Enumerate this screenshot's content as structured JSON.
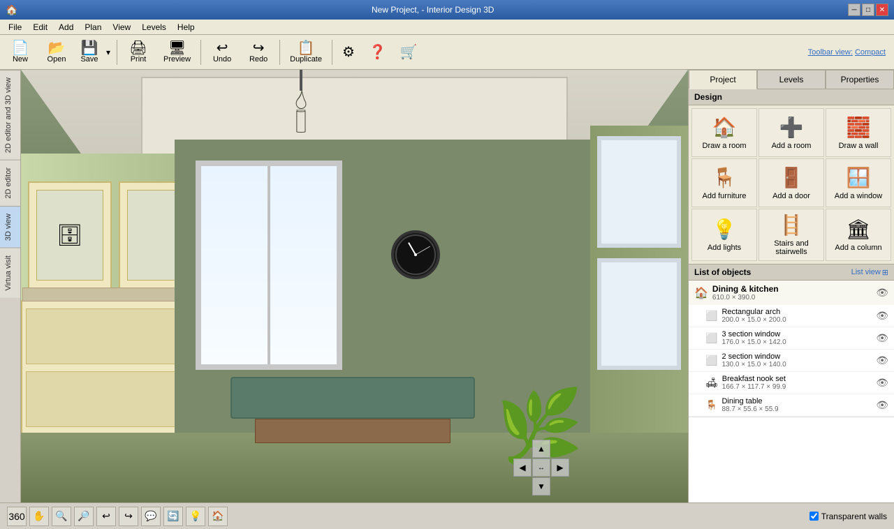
{
  "titlebar": {
    "app_icon": "🏠",
    "title": "New Project, - Interior Design 3D",
    "min_label": "─",
    "restore_label": "□",
    "close_label": "✕"
  },
  "menubar": {
    "items": [
      "File",
      "Edit",
      "Add",
      "Plan",
      "View",
      "Levels",
      "Help"
    ]
  },
  "toolbar": {
    "new_label": "New",
    "open_label": "Open",
    "save_label": "Save",
    "print_label": "Print",
    "preview_label": "Preview",
    "undo_label": "Undo",
    "redo_label": "Redo",
    "duplicate_label": "Duplicate",
    "settings_label": "⚙",
    "help_label": "?",
    "buy_label": "🛒",
    "toolbar_view_label": "Toolbar view:",
    "compact_label": "Compact"
  },
  "left_sidebar": {
    "tabs": [
      {
        "id": "2d-3d-editor",
        "label": "2D editor and 3D view"
      },
      {
        "id": "2d-editor",
        "label": "2D editor"
      },
      {
        "id": "3d-view",
        "label": "3D view"
      },
      {
        "id": "virtual-visit",
        "label": "Virtua visit"
      }
    ]
  },
  "right_panel": {
    "tabs": [
      "Project",
      "Levels",
      "Properties"
    ],
    "active_tab": "Project",
    "design_header": "Design",
    "design_items": [
      {
        "id": "draw-room",
        "icon": "🏠",
        "label": "Draw a room"
      },
      {
        "id": "add-room",
        "icon": "➕",
        "label": "Add a room"
      },
      {
        "id": "draw-wall",
        "icon": "🧱",
        "label": "Draw a wall"
      },
      {
        "id": "add-furniture",
        "icon": "🪑",
        "label": "Add furniture"
      },
      {
        "id": "add-door",
        "icon": "🚪",
        "label": "Add a door"
      },
      {
        "id": "add-window",
        "icon": "🪟",
        "label": "Add a window"
      },
      {
        "id": "add-lights",
        "icon": "💡",
        "label": "Add lights"
      },
      {
        "id": "stairs",
        "icon": "🪜",
        "label": "Stairs and stairwells"
      },
      {
        "id": "add-column",
        "icon": "🏛",
        "label": "Add a column"
      }
    ],
    "objects_header": "List of objects",
    "list_view_label": "List view",
    "objects": [
      {
        "id": "dining-kitchen",
        "name": "Dining & kitchen",
        "dims": "610.0 × 390.0",
        "icon": "🏠",
        "children": [
          {
            "id": "rectangular-arch",
            "name": "Rectangular arch",
            "dims": "200.0 × 15.0 × 200.0",
            "icon": "⬜"
          },
          {
            "id": "3-section-window",
            "name": "3 section window",
            "dims": "176.0 × 15.0 × 142.0",
            "icon": "⬜"
          },
          {
            "id": "2-section-window",
            "name": "2 section window",
            "dims": "130.0 × 15.0 × 140.0",
            "icon": "⬜"
          },
          {
            "id": "breakfast-nook",
            "name": "Breakfast nook set",
            "dims": "166.7 × 117.7 × 99.9",
            "icon": "🛋"
          },
          {
            "id": "dining-table",
            "name": "Dining table",
            "dims": "88.7 × 55.6 × 55.9",
            "icon": "🪑"
          }
        ]
      }
    ]
  },
  "bottom_toolbar": {
    "buttons": [
      "360",
      "✋",
      "🔍-",
      "🔍+",
      "↩",
      "↪",
      "💬",
      "🔄",
      "💡",
      "🏠"
    ],
    "transparent_walls_label": "Transparent walls",
    "transparent_walls_checked": true
  }
}
